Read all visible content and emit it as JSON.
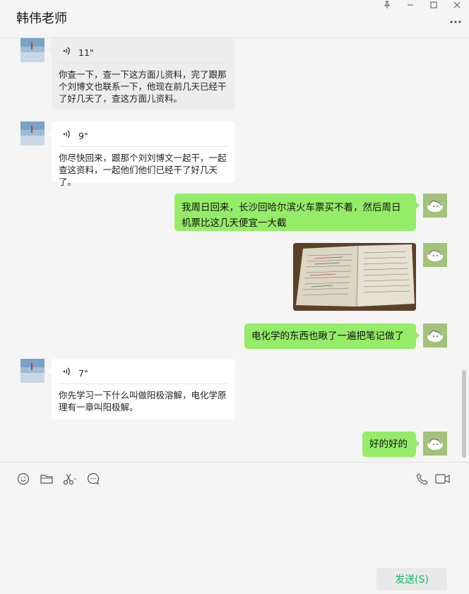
{
  "window": {
    "title": "韩伟老师"
  },
  "messages": [
    {
      "type": "voice",
      "duration": "11\"",
      "transcript": "你查一下，查一下这方面儿资料，完了跟那个刘博文也联系一下，他现在前几天已经干了好几天了，查这方面儿资料。"
    },
    {
      "type": "voice",
      "duration": "9\"",
      "transcript": "你尽快回来，跟那个刘刘博文一起干，一起查这资料，一起他们他们已经干了好几天了。"
    },
    {
      "type": "text",
      "text": "我周日回来，长沙回哈尔滨火车票买不着，然后周日机票比这几天便宜一大截"
    },
    {
      "type": "image",
      "description": "notebook-photo"
    },
    {
      "type": "text",
      "text": "电化学的东西也瞅了一遍把笔记做了"
    },
    {
      "type": "voice",
      "duration": "7\"",
      "transcript": "你先学习一下什么叫做阳极溶解，电化学原理有一章叫阳极解。"
    },
    {
      "type": "text",
      "text": "好的好的"
    }
  ],
  "input": {
    "value": "",
    "send_label": "发送(S)"
  },
  "colors": {
    "accent": "#07c160",
    "outgoing_bubble": "#95ec69",
    "incoming_bubble": "#ffffff"
  }
}
